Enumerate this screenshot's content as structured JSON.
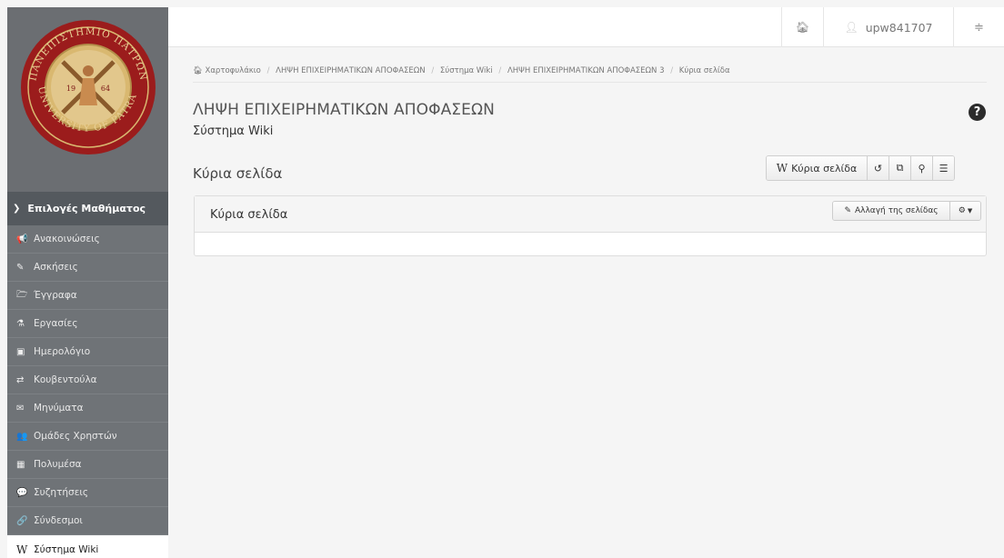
{
  "topbar": {
    "home_icon": "home-icon",
    "user_icon": "user-icon",
    "username": "upw841707",
    "settings_icon": "sliders-icon"
  },
  "logo": {
    "seal_text_top": "ΠΑΝΕΠΙΣΤΗΜΙΟ ΠΑΤΡΩΝ",
    "seal_text_bottom": "UNIVERSITY OF PATRAS",
    "year_left": "19",
    "year_right": "64"
  },
  "sidebar": {
    "header": "Επιλογές Μαθήματος",
    "items": [
      {
        "label": "Ανακοινώσεις",
        "icon": "bullhorn-icon",
        "glyph": "📢"
      },
      {
        "label": "Ασκήσεις",
        "icon": "edit-icon",
        "glyph": "✎"
      },
      {
        "label": "Έγγραφα",
        "icon": "folder-open-icon",
        "glyph": "🗁"
      },
      {
        "label": "Εργασίες",
        "icon": "flask-icon",
        "glyph": "⚗"
      },
      {
        "label": "Ημερολόγιο",
        "icon": "calendar-icon",
        "glyph": "▣"
      },
      {
        "label": "Κουβεντούλα",
        "icon": "exchange-icon",
        "glyph": "⇄"
      },
      {
        "label": "Μηνύματα",
        "icon": "envelope-icon",
        "glyph": "✉"
      },
      {
        "label": "Ομάδες Χρηστών",
        "icon": "users-icon",
        "glyph": "👥"
      },
      {
        "label": "Πολυμέσα",
        "icon": "film-icon",
        "glyph": "▦"
      },
      {
        "label": "Συζητήσεις",
        "icon": "comments-icon",
        "glyph": "💬"
      },
      {
        "label": "Σύνδεσμοι",
        "icon": "link-icon",
        "glyph": "🔗"
      },
      {
        "label": "Σύστημα Wiki",
        "icon": "wikipedia-icon",
        "glyph": "W",
        "active": true
      }
    ]
  },
  "breadcrumb": {
    "items": [
      "Χαρτοφυλάκιο",
      "ΛΗΨΗ ΕΠΙΧΕΙΡΗΜΑΤΙΚΩΝ ΑΠΟΦΑΣΕΩΝ",
      "Σύστημα Wiki",
      "ΛΗΨΗ ΕΠΙΧΕΙΡΗΜΑΤΙΚΩΝ ΑΠΟΦΑΣΕΩΝ 3",
      "Κύρια σελίδα"
    ]
  },
  "course": {
    "title": "ΛΗΨΗ ΕΠΙΧΕΙΡΗΜΑΤΙΚΩΝ ΑΠΟΦΑΣΕΩΝ",
    "subtitle": "Σύστημα Wiki"
  },
  "page": {
    "heading": "Κύρια σελίδα",
    "toolbar": {
      "home_label": "Κύρια σελίδα",
      "home_glyph": "W"
    },
    "panel": {
      "title": "Κύρια σελίδα",
      "edit_label": "Αλλαγή της σελίδας"
    }
  },
  "colors": {
    "sidebar_bg": "#6f7377",
    "sidebar_header_bg": "#54595e",
    "page_bg": "#f5f5f5",
    "seal_red": "#9b1c1c",
    "seal_gold": "#d9b870"
  }
}
